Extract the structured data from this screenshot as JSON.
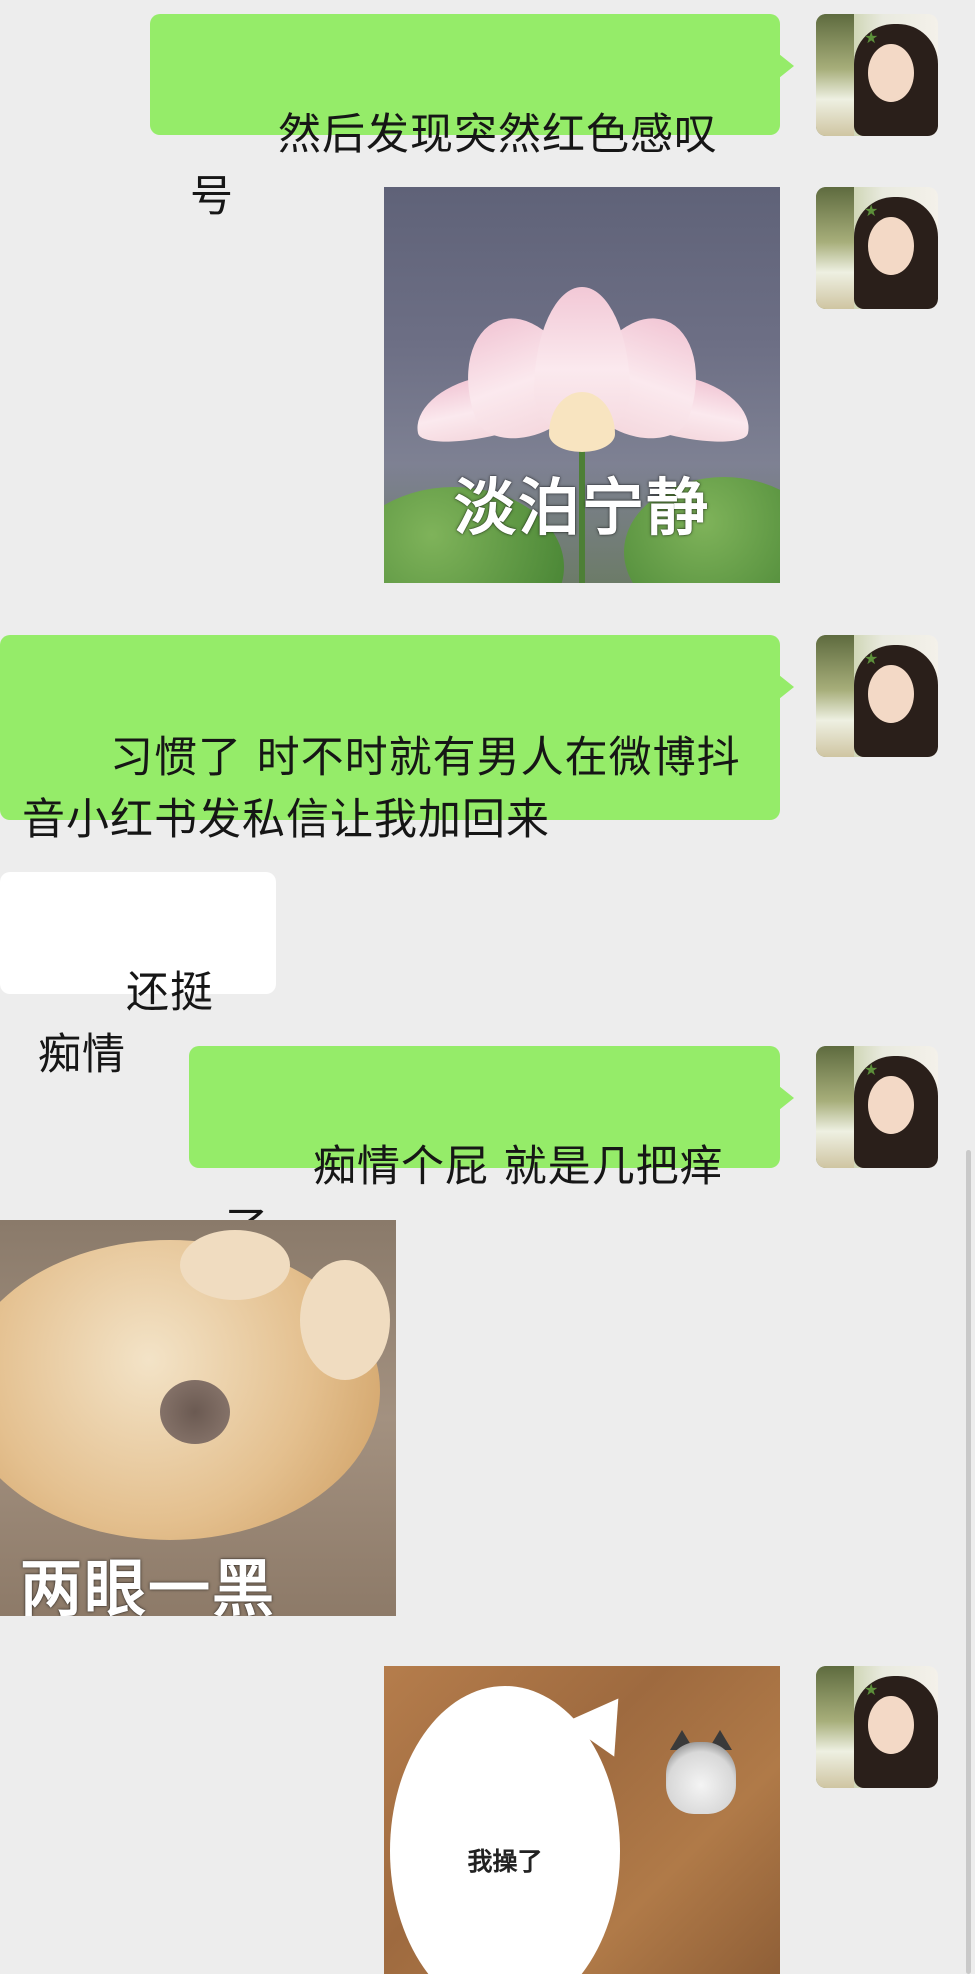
{
  "messages": [
    {
      "id": "m1",
      "sender": "me",
      "type": "text",
      "text": "然后发现突然红色感叹号"
    },
    {
      "id": "m2",
      "sender": "me",
      "type": "sticker",
      "sticker": "lotus",
      "caption": "淡泊宁静"
    },
    {
      "id": "m3",
      "sender": "me",
      "type": "text",
      "text": "习惯了 时不时就有男人在微博抖\n音小红书发私信让我加回来"
    },
    {
      "id": "m4",
      "sender": "other",
      "type": "text",
      "text": "还挺痴情"
    },
    {
      "id": "m5",
      "sender": "me",
      "type": "text",
      "text": "痴情个屁 就是几把痒了"
    },
    {
      "id": "m6",
      "sender": "other",
      "type": "sticker",
      "sticker": "dog",
      "caption": "两眼一黑"
    },
    {
      "id": "m7",
      "sender": "me",
      "type": "sticker",
      "sticker": "cat",
      "caption": "我操了"
    }
  ],
  "colors": {
    "background": "#ededed",
    "my_bubble": "#95ec69",
    "other_bubble": "#ffffff",
    "text": "#161616"
  },
  "icons": {
    "avatar": "user-avatar-photo"
  }
}
